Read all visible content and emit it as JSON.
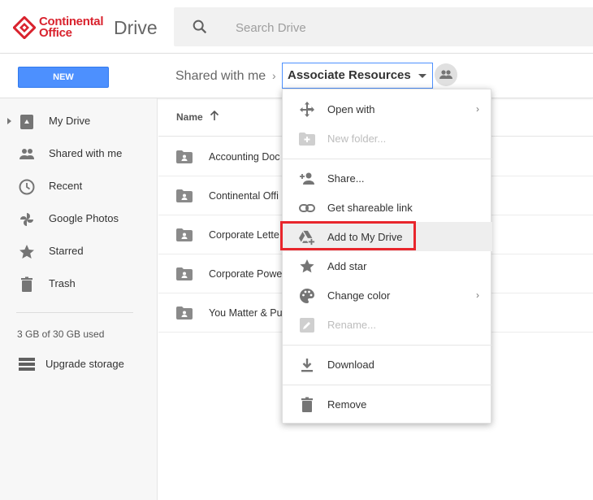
{
  "header": {
    "brand_line1": "Continental",
    "brand_line2": "Office",
    "product": "Drive",
    "search_placeholder": "Search Drive"
  },
  "toolbar": {
    "new_label": "NEW",
    "breadcrumb_parent": "Shared with me",
    "breadcrumb_separator": "›",
    "breadcrumb_current": "Associate Resources"
  },
  "sidebar": {
    "items": [
      {
        "label": "My Drive",
        "icon": "my-drive-icon"
      },
      {
        "label": "Shared with me",
        "icon": "people-icon"
      },
      {
        "label": "Recent",
        "icon": "clock-icon"
      },
      {
        "label": "Google Photos",
        "icon": "pinwheel-icon"
      },
      {
        "label": "Starred",
        "icon": "star-icon"
      },
      {
        "label": "Trash",
        "icon": "trash-icon"
      }
    ],
    "storage": "3 GB of 30 GB used",
    "upgrade_label": "Upgrade storage"
  },
  "list": {
    "column_name": "Name",
    "sort": "ascending",
    "rows": [
      {
        "name": "Accounting Doc"
      },
      {
        "name": "Continental Offi"
      },
      {
        "name": "Corporate Lette"
      },
      {
        "name": "Corporate Powe"
      },
      {
        "name": "You Matter & Pu"
      }
    ]
  },
  "context_menu": {
    "items": [
      {
        "label": "Open with",
        "icon": "move-arrows-icon",
        "submenu": true,
        "disabled": false
      },
      {
        "label": "New folder...",
        "icon": "new-folder-icon",
        "submenu": false,
        "disabled": true
      },
      {
        "label": "Share...",
        "icon": "add-person-icon",
        "submenu": false,
        "disabled": false
      },
      {
        "label": "Get shareable link",
        "icon": "link-icon",
        "submenu": false,
        "disabled": false
      },
      {
        "label": "Add to My Drive",
        "icon": "drive-add-icon",
        "submenu": false,
        "disabled": false,
        "highlighted": true
      },
      {
        "label": "Add star",
        "icon": "star-icon",
        "submenu": false,
        "disabled": false
      },
      {
        "label": "Change color",
        "icon": "palette-icon",
        "submenu": true,
        "disabled": false
      },
      {
        "label": "Rename...",
        "icon": "rename-icon",
        "submenu": false,
        "disabled": true
      },
      {
        "label": "Download",
        "icon": "download-icon",
        "submenu": false,
        "disabled": false
      },
      {
        "label": "Remove",
        "icon": "trash-icon",
        "submenu": false,
        "disabled": false
      }
    ],
    "submenu_glyph": "›"
  },
  "colors": {
    "brand_red": "#d9232e",
    "primary_blue": "#4d90fe",
    "highlight_red": "#e8262c",
    "icon_gray": "#757575"
  }
}
